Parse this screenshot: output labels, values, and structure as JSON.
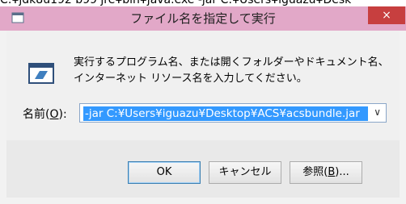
{
  "background_clip_text": "C:¥jdk8u192 b99 jre¥bin¥java.exe -jar C:¥Users¥iguazu¥Desk",
  "window": {
    "title": "ファイル名を指定して実行",
    "close_glyph": "×",
    "description": "実行するプログラム名、または開くフォルダーやドキュメント名、インターネット リソース名を入力してください。",
    "name_label_prefix": "名前(",
    "name_label_accel": "O",
    "name_label_suffix": "):",
    "command_value": "-jar C:¥Users¥iguazu¥Desktop¥ACS¥acsbundle.jar",
    "dropdown_glyph": "∨",
    "buttons": {
      "ok": "OK",
      "cancel": "キャンセル",
      "browse_prefix": "参照(",
      "browse_accel": "B",
      "browse_suffix": ")..."
    }
  },
  "icons": {
    "app": "run-dialog-icon",
    "close": "close-icon",
    "run": "run-program-icon",
    "dropdown": "chevron-down-icon"
  },
  "colors": {
    "titlebar": "#e2a8c8",
    "close_button": "#c73f3f",
    "selection": "#3399ff"
  }
}
